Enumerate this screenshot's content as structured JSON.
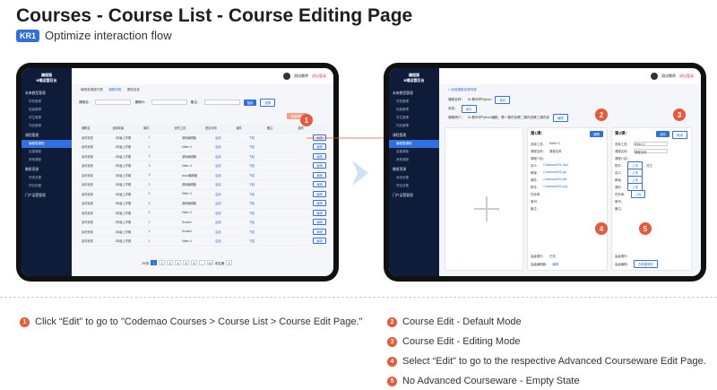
{
  "title": "Courses - Course List - Course Editing Page",
  "kr": {
    "badge": "KR1",
    "text": "Optimize interaction flow"
  },
  "left_screen": {
    "sidebar": {
      "logo": [
        "编程猫",
        "B端运营后台"
      ],
      "groups": [
        "未来教室管理",
        "课程管理",
        "教研资源",
        "门户运营管理"
      ],
      "items": [
        "学校管理",
        "班级管理",
        "学生管理",
        "作品管理",
        "课程管理",
        "编程猫课程",
        "自建课程",
        "其他课程",
        "资源管理",
        "系统设置",
        "项目设置",
        "学校配置"
      ]
    },
    "topbar": {
      "user": "测试教师",
      "logout": "退出登录"
    },
    "tabs": [
      "编程猫课程列表",
      "课程列表",
      "课程信息"
    ],
    "filters": {
      "name_label": "课程名：",
      "name_placeholder": "请输入关键字",
      "id_label": "课程ID：",
      "id_placeholder": "请输入关键字",
      "note_label": "备注：",
      "note_placeholder": "请输入关键字",
      "search": "搜索",
      "reset": "重置"
    },
    "add_button": "新建课程",
    "table": {
      "headers": [
        "课程名",
        "适用年级",
        "课次",
        "创作工具",
        "是否可用",
        "课件",
        "备注",
        "操作"
      ],
      "rows": [
        [
          "素材资源",
          "1年级上学期",
          "1",
          "源码编辑器",
          "启用",
          "下载",
          "",
          "编辑"
        ],
        [
          "素材资源",
          "1年级上学期",
          "1",
          "Kitten 3",
          "启用",
          "下载",
          "",
          "编辑"
        ],
        [
          "素材资源",
          "1年级上学期",
          "2",
          "源码编辑器",
          "启用",
          "下载",
          "",
          "编辑"
        ],
        [
          "素材资源",
          "1年级上学期",
          "3",
          "Kitten 4",
          "启用",
          "下载",
          "",
          "编辑"
        ],
        [
          "素材资源",
          "1年级上学期",
          "3",
          "wood编辑器",
          "启用",
          "下载",
          "",
          "编辑"
        ],
        [
          "素材资源",
          "1年级上学期",
          "3",
          "源码编辑器",
          "启用",
          "下载",
          "",
          "编辑"
        ],
        [
          "素材资源",
          "1年级上学期",
          "4",
          "Kitten 3",
          "启用",
          "下载",
          "",
          "编辑"
        ],
        [
          "素材资源",
          "1年级上学期",
          "4",
          "源码编辑器",
          "启用",
          "下载",
          "",
          "编辑"
        ],
        [
          "素材资源",
          "1年级上学期",
          "4",
          "Kitten 3",
          "启用",
          "下载",
          "",
          "编辑"
        ],
        [
          "素材资源",
          "1年级上学期",
          "1",
          "Scratch",
          "启用",
          "下载",
          "",
          "编辑"
        ],
        [
          "素材资源",
          "1年级上学期",
          "1",
          "Scratch",
          "启用",
          "下载",
          "",
          "编辑"
        ],
        [
          "素材资源",
          "1年级上学期",
          "1",
          "Kitten 4",
          "启用",
          "下载",
          "",
          "编辑"
        ]
      ]
    },
    "pager": {
      "size": "20/页",
      "pages": [
        "1",
        "2",
        "3",
        "4",
        "5",
        "6",
        "...",
        "10"
      ],
      "goto": "前往第",
      "page_input": "1"
    }
  },
  "right_screen": {
    "breadcrumb": "< 返回课程目录列表",
    "form": {
      "name_label": "课程名称：",
      "name_value": "AI 教你学Python",
      "save": "保存",
      "status_label": "状态：",
      "save2": "保存",
      "desc_label": "课程简介：",
      "desc_value": "AI 教你学Python编程，第一课内容第二课内容第三课内容",
      "edit": "编辑"
    },
    "lesson1": {
      "title": "第1课：",
      "edit": "编辑",
      "rows": [
        "选择工具：",
        "课程名称：",
        "课程介绍：",
        "附件：",
        "讲义：",
        "教案：",
        "课件：",
        "任务单：",
        "素材：",
        "备注："
      ],
      "tool": "Kitten 3",
      "name": "课程名称",
      "files": [
        "Codemao001.mp4",
        "Codemao001.ppt",
        "Codemao001.pdf",
        "Codemao001.png"
      ],
      "adv_label": "高级课件：",
      "adv_value": "已完",
      "adv_editor": "高级编辑器：",
      "adv_link": "编辑"
    },
    "lesson2": {
      "title": "第2课：",
      "save": "保存",
      "cancel": "取消",
      "tool": "Kitten 3",
      "name": "课程名称",
      "rows": [
        "选择工具：",
        "课程名称：",
        "课程介绍：",
        "附件：",
        "讲义：",
        "教案：",
        "课件：",
        "任务单：",
        "素材：",
        "备注："
      ],
      "upload": "上传",
      "clear": "清空",
      "adv_label": "高级课件：",
      "adv_editor": "高级编辑：",
      "adv_link": "去新建课件"
    }
  },
  "markers": [
    "1",
    "2",
    "3",
    "4",
    "5"
  ],
  "legend": [
    {
      "num": "1",
      "text": "Click “Edit” to go to \"Codemao Courses > Course List > Course Edit Page.\""
    },
    {
      "num": "2",
      "text": "Course Edit - Default Mode"
    },
    {
      "num": "3",
      "text": "Course Edit - Editing Mode"
    },
    {
      "num": "4",
      "text": "Select “Edit” to go to the respective Advanced Courseware Edit Page."
    },
    {
      "num": "5",
      "text": "No Advanced Courseware - Empty State"
    }
  ],
  "colors": {
    "accent": "#2f6fe0",
    "marker": "#e8593b",
    "sidebar": "#0e1c3a",
    "arrow": "#cfe0f7"
  }
}
